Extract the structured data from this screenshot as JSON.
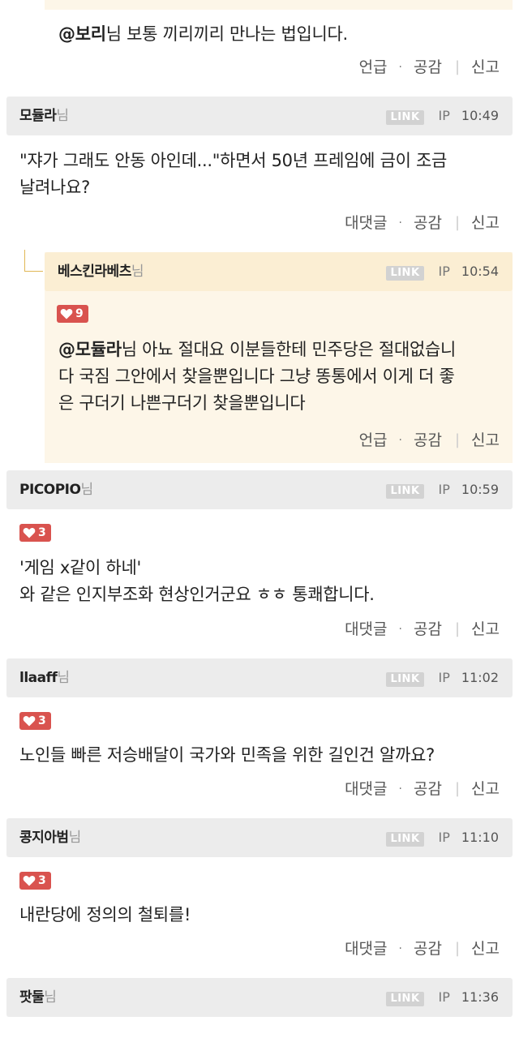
{
  "link_label": "LINK",
  "ip_label": "IP",
  "nim_suffix": "님",
  "actions": {
    "mention": "언급",
    "reply": "대댓글",
    "empathy": "공감",
    "report": "신고"
  },
  "top_reply": {
    "mention": "@보리",
    "text": "님 보통 끼리끼리 만나는 법입니다."
  },
  "comments": [
    {
      "author": "모듈라",
      "time": "10:49",
      "lines": [
        "\"쟈가 그래도 안동 아인데...\"하면서 50년 프레임에 금이 조금",
        "날려나요?"
      ]
    },
    {
      "author": "베스킨라베츠",
      "time": "10:54",
      "likes": "9",
      "mention": "@모듈라",
      "lines": [
        "님 아뇨 절대요 이분들한테 민주당은 절대없습니",
        "다 국짐 그안에서 찾을뿐입니다 그냥 똥통에서 이게 더 좋",
        "은 구더기 나쁜구더기 찾을뿐입니다"
      ]
    },
    {
      "author": "PICOPIO",
      "time": "10:59",
      "likes": "3",
      "lines": [
        "'게임 x같이 하네'",
        "와 같은 인지부조화 현상인거군요 ㅎㅎ 통쾌합니다."
      ]
    },
    {
      "author": "llaaff",
      "time": "11:02",
      "likes": "3",
      "lines": [
        "노인들 빠른 저승배달이 국가와 민족을 위한 길인건 알까요?"
      ]
    },
    {
      "author": "콩지아범",
      "time": "11:10",
      "likes": "3",
      "lines": [
        "내란당에 정의의 철퇴를!"
      ]
    },
    {
      "author": "팟둘",
      "time": "11:36"
    }
  ]
}
